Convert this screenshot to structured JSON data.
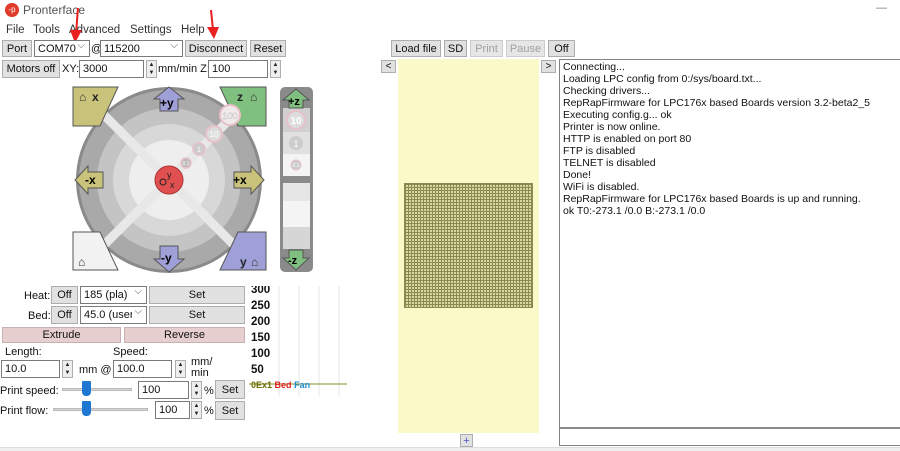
{
  "window": {
    "title": "Pronterface",
    "minimize": "—"
  },
  "menu": [
    "File",
    "Tools",
    "Advanced",
    "Settings",
    "Help"
  ],
  "connection": {
    "port_label": "Port",
    "port_value": "COM70",
    "at": "@",
    "baud_value": "115200",
    "disconnect": "Disconnect",
    "reset": "Reset"
  },
  "motion": {
    "motors_off": "Motors off",
    "xy_label": "XY:",
    "xy_value": "3000",
    "mm_min_z": "mm/min Z:",
    "z_value": "100"
  },
  "jog": {
    "home_x": "x",
    "home_z": "z",
    "plus_y": "+y",
    "minus_y": "-y",
    "plus_x": "+x",
    "minus_x": "-x",
    "home_y": "y",
    "steps": [
      "100",
      "10",
      "1",
      "0.1"
    ],
    "plus_z": "+z",
    "minus_z": "-z",
    "z_steps": [
      "10",
      "1",
      "0.1"
    ]
  },
  "temps": {
    "heat_label": "Heat:",
    "heat_off": "Off",
    "heat_value": "185 (pla)",
    "heat_set": "Set",
    "bed_label": "Bed:",
    "bed_off": "Off",
    "bed_value": "45.0 (user)",
    "bed_set": "Set"
  },
  "extrude": {
    "extrude": "Extrude",
    "reverse": "Reverse",
    "length_label": "Length:",
    "length_value": "10.0",
    "mm_at": "mm @",
    "speed_label": "Speed:",
    "speed_value": "100.0",
    "speed_unit": "mm/ min"
  },
  "print_speed": {
    "label": "Print speed:",
    "value": "100",
    "unit": "%",
    "set": "Set",
    "slider_percent": 100
  },
  "print_flow": {
    "label": "Print flow:",
    "value": "100",
    "unit": "%",
    "set": "Set",
    "slider_percent": 100
  },
  "graph": {
    "ticks": [
      "300",
      "250",
      "200",
      "150",
      "100",
      "50"
    ],
    "legend": [
      {
        "text": "0Ex1",
        "color": "#6b6b00"
      },
      {
        "text": "Bed",
        "color": "#e02020"
      },
      {
        "text": "Fan",
        "color": "#2090d0"
      }
    ]
  },
  "file_toolbar": {
    "load": "Load file",
    "sd": "SD",
    "print": "Print",
    "pause": "Pause",
    "off": "Off",
    "prev": "<",
    "next": ">",
    "add": "+"
  },
  "log": [
    "Connecting...",
    "Loading LPC config from 0:/sys/board.txt...",
    "Checking drivers...",
    "RepRapFirmware for LPC176x based Boards version 3.2-beta2_5",
    "Executing config.g... ok",
    "Printer is now online.",
    "HTTP is enabled on port 80",
    "FTP is disabled",
    "TELNET is disabled",
    "Done!",
    "WiFi is disabled.",
    "RepRapFirmware for LPC176x based Boards is up and running.",
    "ok T0:-273.1 /0.0 B:-273.1 /0.0"
  ]
}
